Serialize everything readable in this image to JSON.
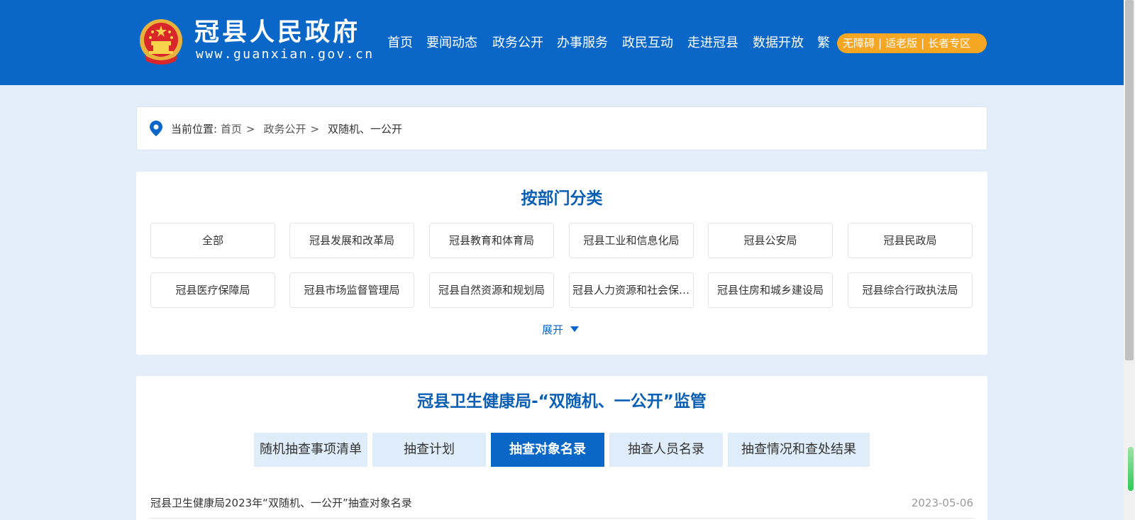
{
  "header": {
    "site_title": "冠县人民政府",
    "site_url": "www.guanxian.gov.cn",
    "nav": [
      "首页",
      "要闻动态",
      "政务公开",
      "办事服务",
      "政民互动",
      "走进冠县",
      "数据开放",
      "繁"
    ],
    "access": [
      "无障碍",
      "适老版",
      "长者专区"
    ],
    "colors": {
      "header_bg": "#0a67c8",
      "access_bg": "#f5a623"
    }
  },
  "breadcrumb": {
    "prefix": "当前位置:",
    "items": [
      "首页",
      "政务公开",
      "双随机、一公开"
    ],
    "sep": ">"
  },
  "categories": {
    "title": "按部门分类",
    "items": [
      "全部",
      "冠县发展和改革局",
      "冠县教育和体育局",
      "冠县工业和信息化局",
      "冠县公安局",
      "冠县民政局",
      "冠县医疗保障局",
      "冠县市场监督管理局",
      "冠县自然资源和规划局",
      "冠县人力资源和社会保障局",
      "冠县住房和城乡建设局",
      "冠县综合行政执法局"
    ],
    "expand_label": "展开"
  },
  "supervision": {
    "title": "冠县卫生健康局-“双随机、一公开”监管",
    "tabs": [
      "随机抽查事项清单",
      "抽查计划",
      "抽查对象名录",
      "抽查人员名录",
      "抽查情况和查处结果"
    ],
    "active_tab": 2,
    "rows": [
      {
        "title": "冠县卫生健康局2023年“双随机、一公开”抽查对象名录",
        "date": "2023-05-06"
      }
    ]
  }
}
